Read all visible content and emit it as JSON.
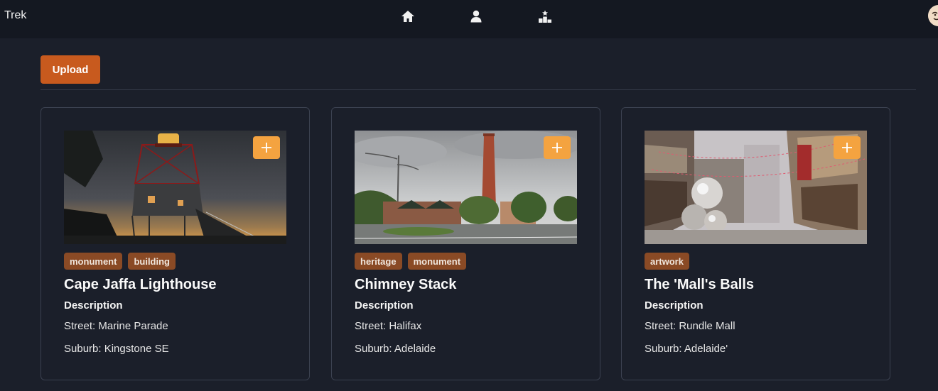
{
  "app": {
    "brand": "Trek"
  },
  "nav": {
    "icons": [
      "home-icon",
      "user-icon",
      "leaderboard-icon"
    ]
  },
  "toolbar": {
    "upload_label": "Upload"
  },
  "cards": [
    {
      "title": "Cape Jaffa Lighthouse",
      "tags": [
        "monument",
        "building"
      ],
      "description_label": "Description",
      "street": "Street: Marine Parade",
      "suburb": "Suburb: Kingstone SE"
    },
    {
      "title": "Chimney Stack",
      "tags": [
        "heritage",
        "monument"
      ],
      "description_label": "Description",
      "street": "Street: Halifax",
      "suburb": "Suburb: Adelaide"
    },
    {
      "title": "The 'Mall's Balls",
      "tags": [
        "artwork"
      ],
      "description_label": "Description",
      "street": "Street: Rundle Mall",
      "suburb": "Suburb: Adelaide'"
    }
  ],
  "colors": {
    "background": "#1b1f2a",
    "topbar": "#141821",
    "accent": "#c85a1e",
    "add_button": "#f4a340",
    "tag": "#8a4a25"
  }
}
